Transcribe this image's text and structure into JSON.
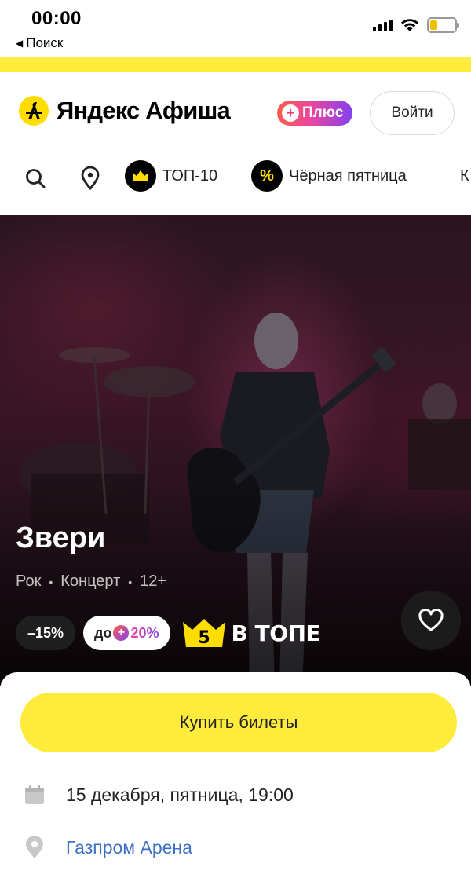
{
  "status_bar": {
    "time": "00:00",
    "back_label": "Поиск",
    "battery_level": 0.3
  },
  "header": {
    "logo_text": "Яндекс Афиша",
    "plus_label": "Плюс",
    "login_label": "Войти"
  },
  "nav": {
    "items": [
      {
        "label": "ТОП-10",
        "icon": "crown-icon"
      },
      {
        "label": "Чёрная пятница",
        "icon": "percent-icon"
      },
      {
        "label": "К"
      }
    ]
  },
  "event": {
    "title": "Звери",
    "tags": [
      "Рок",
      "Концерт",
      "12+"
    ],
    "discount": "–15%",
    "plus_prefix": "до",
    "plus_value": "20%",
    "top_rank": "5",
    "top_label": "В ТОПЕ"
  },
  "sheet": {
    "buy_label": "Купить билеты",
    "date": "15 декабря, пятница, 19:00",
    "venue": "Газпром Арена"
  },
  "colors": {
    "accent_yellow": "#ffeb3b",
    "link_blue": "#3c6fc7",
    "plus_gradient_start": "#ff5c4d",
    "plus_gradient_end": "#8341ef"
  }
}
